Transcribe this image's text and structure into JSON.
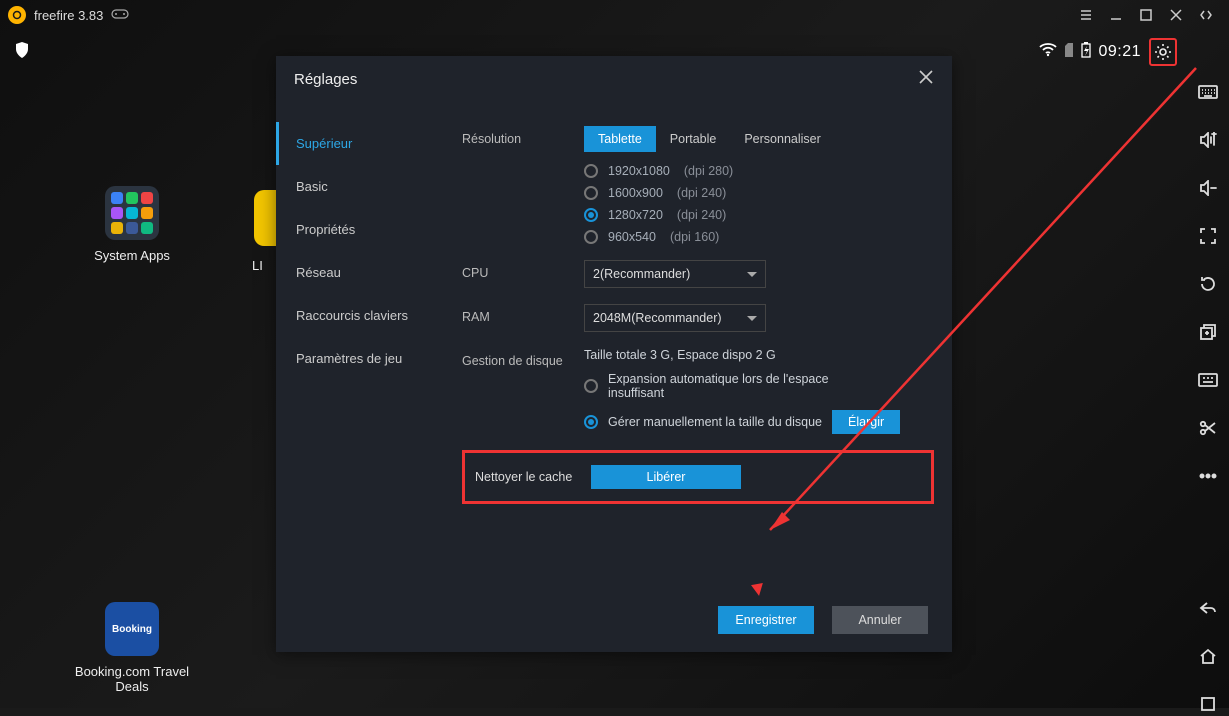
{
  "titlebar": {
    "title": "freefire 3.83"
  },
  "statusbar": {
    "time": "09:21"
  },
  "desktop": {
    "system_apps": "System Apps",
    "system_apps_short": "LI",
    "booking_label": "Booking.com Travel Deals",
    "booking_tile": "Booking"
  },
  "dialog": {
    "title": "Réglages",
    "sidebar": {
      "superior": "Supérieur",
      "basic": "Basic",
      "properties": "Propriétés",
      "network": "Réseau",
      "shortcuts": "Raccourcis claviers",
      "gamesettings": "Paramètres de jeu"
    },
    "labels": {
      "resolution": "Résolution",
      "cpu": "CPU",
      "ram": "RAM",
      "disk": "Gestion de disque",
      "cache": "Nettoyer le cache"
    },
    "resolution": {
      "tablet": "Tablette",
      "portable": "Portable",
      "custom": "Personnaliser",
      "opt1": "1920x1080",
      "dpi1": "(dpi 280)",
      "opt2": "1600x900",
      "dpi2": "(dpi 240)",
      "opt3": "1280x720",
      "dpi3": "(dpi 240)",
      "opt4": "960x540",
      "dpi4": "(dpi 160)"
    },
    "cpu_value": "2(Recommander)",
    "ram_value": "2048M(Recommander)",
    "disk": {
      "summary": "Taille totale  3 G,  Espace dispo  2 G",
      "auto": "Expansion automatique lors de l'espace insuffisant",
      "manual": "Gérer manuellement la taille du disque",
      "enlarge": "Élargir"
    },
    "cache_btn": "Libérer",
    "save": "Enregistrer",
    "cancel": "Annuler"
  }
}
